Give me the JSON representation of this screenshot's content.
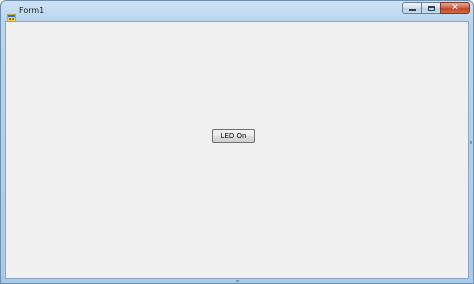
{
  "window": {
    "title": "Form1",
    "icon": "windows-form-icon"
  },
  "caption_buttons": {
    "minimize_icon": "minimize-icon",
    "maximize_icon": "maximize-icon",
    "close_icon": "close-icon",
    "close_glyph": "✕"
  },
  "form": {
    "led_button_label": "LED On"
  },
  "colors": {
    "client_background": "#f0f0f0",
    "title_bar": "#b9d5ef",
    "close_button": "#c04428"
  }
}
